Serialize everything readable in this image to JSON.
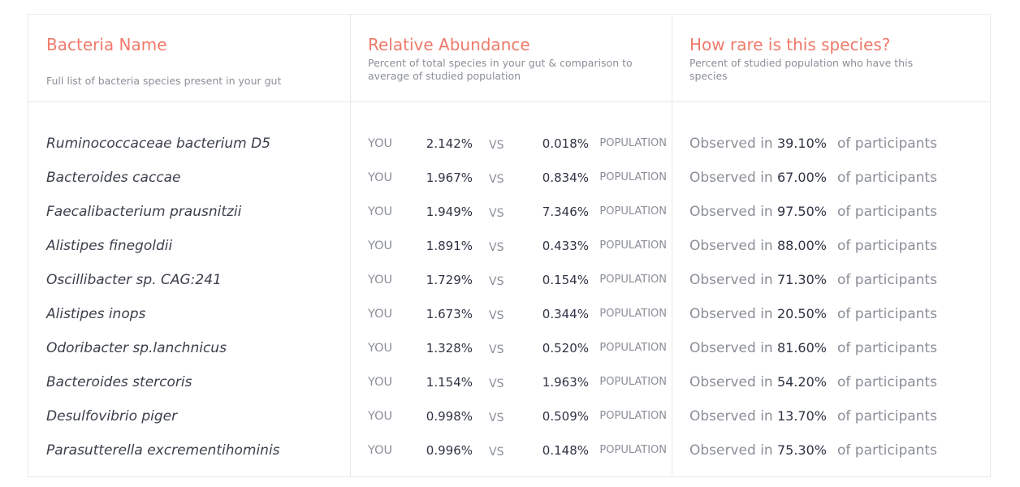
{
  "headers": {
    "name_title": "Bacteria Name",
    "name_sub": "Full list of bacteria species present in your gut",
    "abund_title": "Relative Abundance",
    "abund_sub": "Percent of total species in your gut & comparison to average of studied population",
    "rare_title": "How rare is this species?",
    "rare_sub": "Percent of studied population who have this species"
  },
  "labels": {
    "you": "YOU",
    "vs": "VS",
    "population": "POPULATION",
    "observed": "Observed in",
    "participants": "of participants"
  },
  "rows": [
    {
      "name": "Ruminococcaceae bacterium D5",
      "you": "2.142%",
      "pop": "0.018%",
      "obs": "39.10%"
    },
    {
      "name": "Bacteroides caccae",
      "you": "1.967%",
      "pop": "0.834%",
      "obs": "67.00%"
    },
    {
      "name": "Faecalibacterium prausnitzii",
      "you": "1.949%",
      "pop": "7.346%",
      "obs": "97.50%"
    },
    {
      "name": "Alistipes finegoldii",
      "you": "1.891%",
      "pop": "0.433%",
      "obs": "88.00%"
    },
    {
      "name": "Oscillibacter sp. CAG:241",
      "you": "1.729%",
      "pop": "0.154%",
      "obs": "71.30%"
    },
    {
      "name": "Alistipes inops",
      "you": "1.673%",
      "pop": "0.344%",
      "obs": "20.50%"
    },
    {
      "name": "Odoribacter sp.lanchnicus",
      "you": "1.328%",
      "pop": "0.520%",
      "obs": "81.60%"
    },
    {
      "name": "Bacteroides stercoris",
      "you": "1.154%",
      "pop": "1.963%",
      "obs": "54.20%"
    },
    {
      "name": "Desulfovibrio piger",
      "you": "0.998%",
      "pop": "0.509%",
      "obs": "13.70%"
    },
    {
      "name": "Parasutterella excrementihominis",
      "you": "0.996%",
      "pop": "0.148%",
      "obs": "75.30%"
    }
  ],
  "colors": {
    "accent": "#ef7a6a",
    "text_dark": "#2f3444",
    "text_muted": "#8b8f98",
    "border": "#e9e9ec"
  }
}
